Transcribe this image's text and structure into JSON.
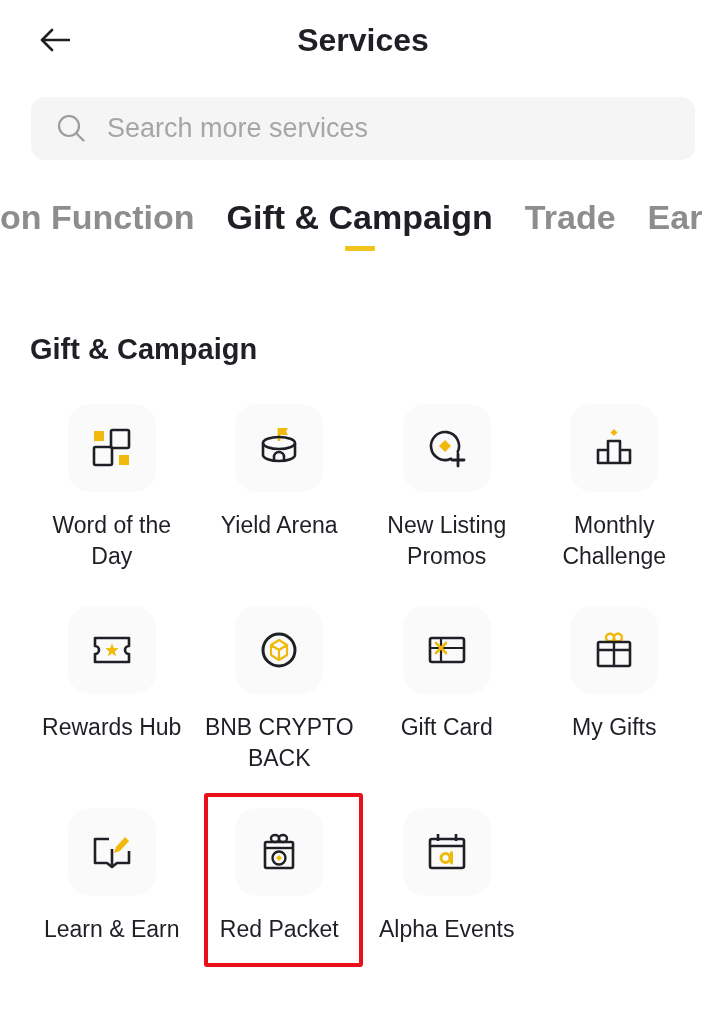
{
  "header": {
    "title": "Services"
  },
  "search": {
    "placeholder": "Search more services"
  },
  "tabs": [
    {
      "label": "on Function",
      "selected": false
    },
    {
      "label": "Gift & Campaign",
      "selected": true
    },
    {
      "label": "Trade",
      "selected": false
    },
    {
      "label": "Ear",
      "selected": false
    }
  ],
  "section": {
    "title": "Gift & Campaign",
    "items": [
      {
        "label": "Word of the\nDay",
        "highlighted": false
      },
      {
        "label": "Yield Arena",
        "highlighted": false
      },
      {
        "label": "New Listing\nPromos",
        "highlighted": false
      },
      {
        "label": "Monthly\nChallenge",
        "highlighted": false
      },
      {
        "label": "Rewards Hub",
        "highlighted": false
      },
      {
        "label": "BNB CRYPTO\nBACK",
        "highlighted": false
      },
      {
        "label": "Gift Card",
        "highlighted": false
      },
      {
        "label": "My Gifts",
        "highlighted": false
      },
      {
        "label": "Learn & Earn",
        "highlighted": false
      },
      {
        "label": "Red Packet",
        "highlighted": true
      },
      {
        "label": "Alpha Events",
        "highlighted": false
      }
    ]
  }
}
